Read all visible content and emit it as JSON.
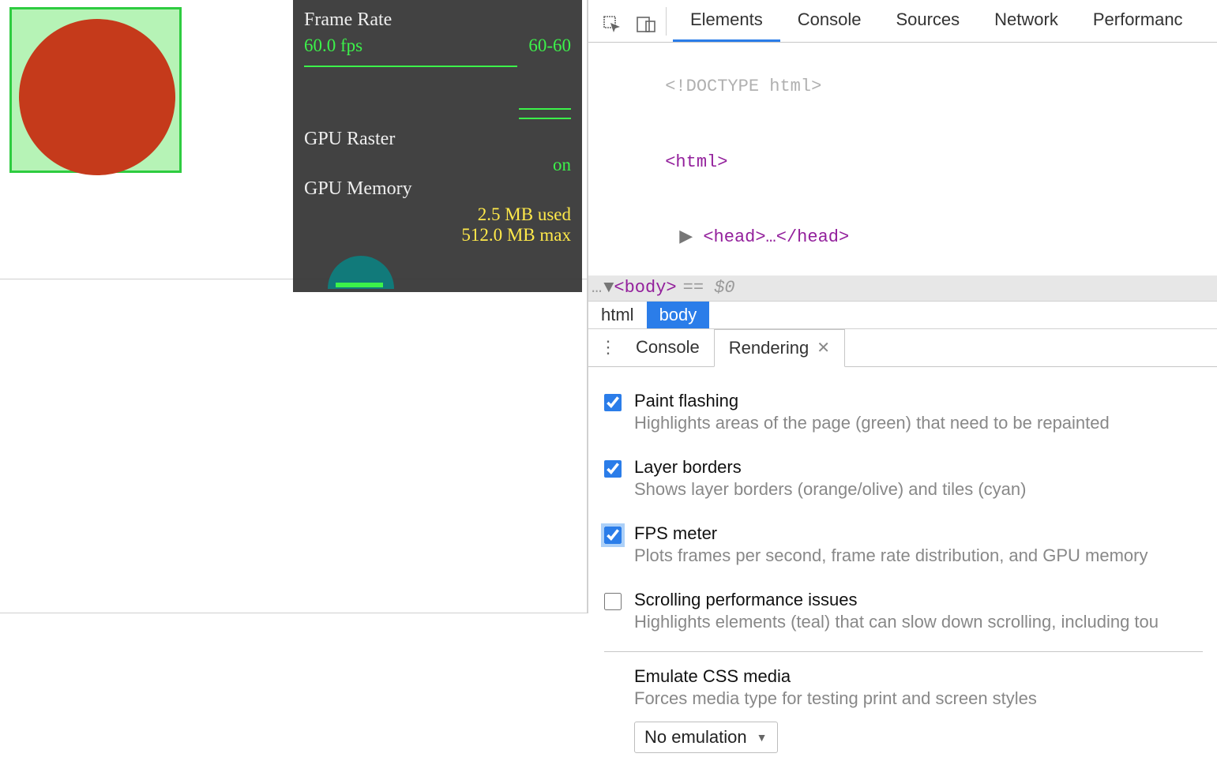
{
  "fps_overlay": {
    "frame_rate_title": "Frame Rate",
    "fps_value": "60.0 fps",
    "fps_range": "60-60",
    "gpu_raster_title": "GPU Raster",
    "gpu_raster_status": "on",
    "gpu_memory_title": "GPU Memory",
    "gpu_mem_used": "2.5 MB used",
    "gpu_mem_max": "512.0 MB max"
  },
  "devtools": {
    "tabs": {
      "elements": "Elements",
      "console": "Console",
      "sources": "Sources",
      "network": "Network",
      "performance": "Performanc"
    },
    "dom": {
      "doctype_open": "<!",
      "doctype_text": "DOCTYPE html",
      "doctype_close": ">",
      "html_open": "<",
      "html_tag": "html",
      "html_close": ">",
      "head_open": "<",
      "head_tag": "head",
      "head_after": ">…</",
      "head_tag2": "head",
      "head_end": ">",
      "body_open": "<",
      "body_tag": "body",
      "body_close": ">",
      "selected_suffix": " == $0",
      "ellipsis": "…"
    },
    "breadcrumb": {
      "html": "html",
      "body": "body"
    },
    "drawer": {
      "console": "Console",
      "rendering": "Rendering"
    },
    "rendering": {
      "paint_flash_title": "Paint flashing",
      "paint_flash_desc": "Highlights areas of the page (green) that need to be repainted",
      "layer_borders_title": "Layer borders",
      "layer_borders_desc": "Shows layer borders (orange/olive) and tiles (cyan)",
      "fps_meter_title": "FPS meter",
      "fps_meter_desc": "Plots frames per second, frame rate distribution, and GPU memory",
      "scroll_perf_title": "Scrolling performance issues",
      "scroll_perf_desc": "Highlights elements (teal) that can slow down scrolling, including tou",
      "emulate_title": "Emulate CSS media",
      "emulate_desc": "Forces media type for testing print and screen styles",
      "emulate_value": "No emulation"
    }
  }
}
